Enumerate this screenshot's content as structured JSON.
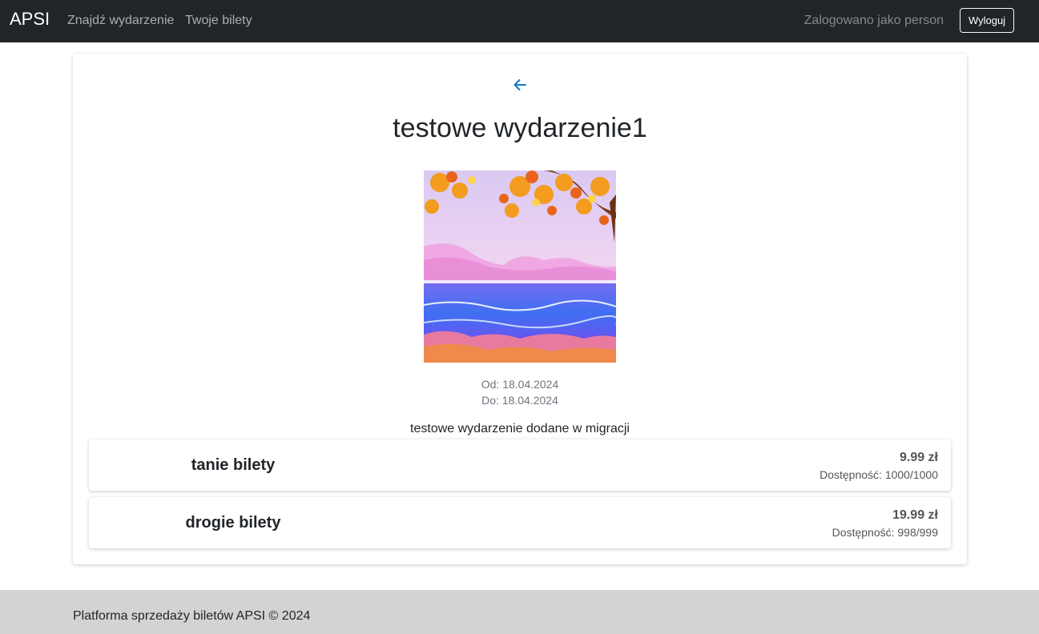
{
  "navbar": {
    "brand": "APSI",
    "links": [
      "Znajdź wydarzenie",
      "Twoje bilety"
    ],
    "logged_in_text": "Zalogowano jako person",
    "logout_label": "Wyloguj"
  },
  "event": {
    "title": "testowe wydarzenie1",
    "date_from": "Od: 18.04.2024",
    "date_to": "Do: 18.04.2024",
    "description": "testowe wydarzenie dodane w migracji",
    "image_icon": "event-image"
  },
  "tickets": [
    {
      "name": "tanie bilety",
      "price": "9.99 zł",
      "availability": "Dostępność: 1000/1000"
    },
    {
      "name": "drogie bilety",
      "price": "19.99 zł",
      "availability": "Dostępność: 998/999"
    }
  ],
  "footer": {
    "text": "Platforma sprzedaży biletów APSI © 2024"
  },
  "colors": {
    "navbar_bg": "#212529",
    "accent": "#0d7ac7",
    "footer_bg": "#d3d3d3"
  },
  "icons": {
    "back": "arrow-left-icon"
  }
}
